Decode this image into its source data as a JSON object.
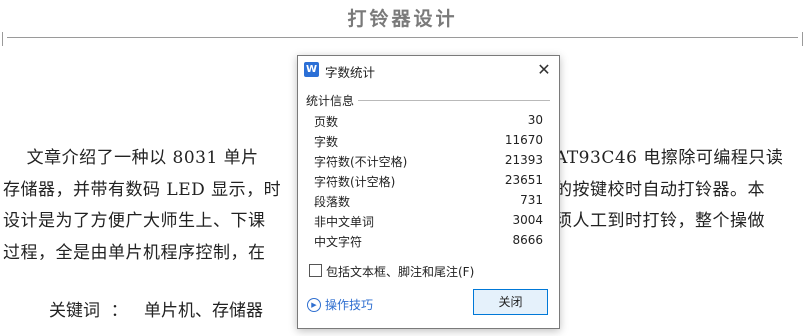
{
  "document": {
    "title": "打铃器设计",
    "lines": [
      "    文章介绍了一种以 8031 单片",
      "存储器，并带有数码 LED 显示，时",
      "设计是为了方便广大师生上、下课",
      "过程，全是由单片机程序控制，在"
    ],
    "right_lines": [
      "AT93C46 电擦除可编程只读",
      "的按键校时自动打铃器。本",
      "须人工到时打铃，整个操做",
      ""
    ],
    "keywords_line": "关键词  ：   单片机、存储器"
  },
  "dialog": {
    "app_icon_letter": "W",
    "title": "字数统计",
    "close_glyph": "✕",
    "group_label": "统计信息",
    "rows": [
      {
        "label": "页数",
        "value": "30"
      },
      {
        "label": "字数",
        "value": "11670"
      },
      {
        "label": "字符数(不计空格)",
        "value": "21393"
      },
      {
        "label": "字符数(计空格)",
        "value": "23651"
      },
      {
        "label": "段落数",
        "value": "731"
      },
      {
        "label": "非中文单词",
        "value": "3004"
      },
      {
        "label": "中文字符",
        "value": "8666"
      }
    ],
    "checkbox_label": "包括文本框、脚注和尾注(F)",
    "checkbox_checked": false,
    "tips_link": "操作技巧",
    "tips_icon": "play-circle-icon",
    "close_button": "关闭",
    "accent_color": "#0078d7"
  }
}
